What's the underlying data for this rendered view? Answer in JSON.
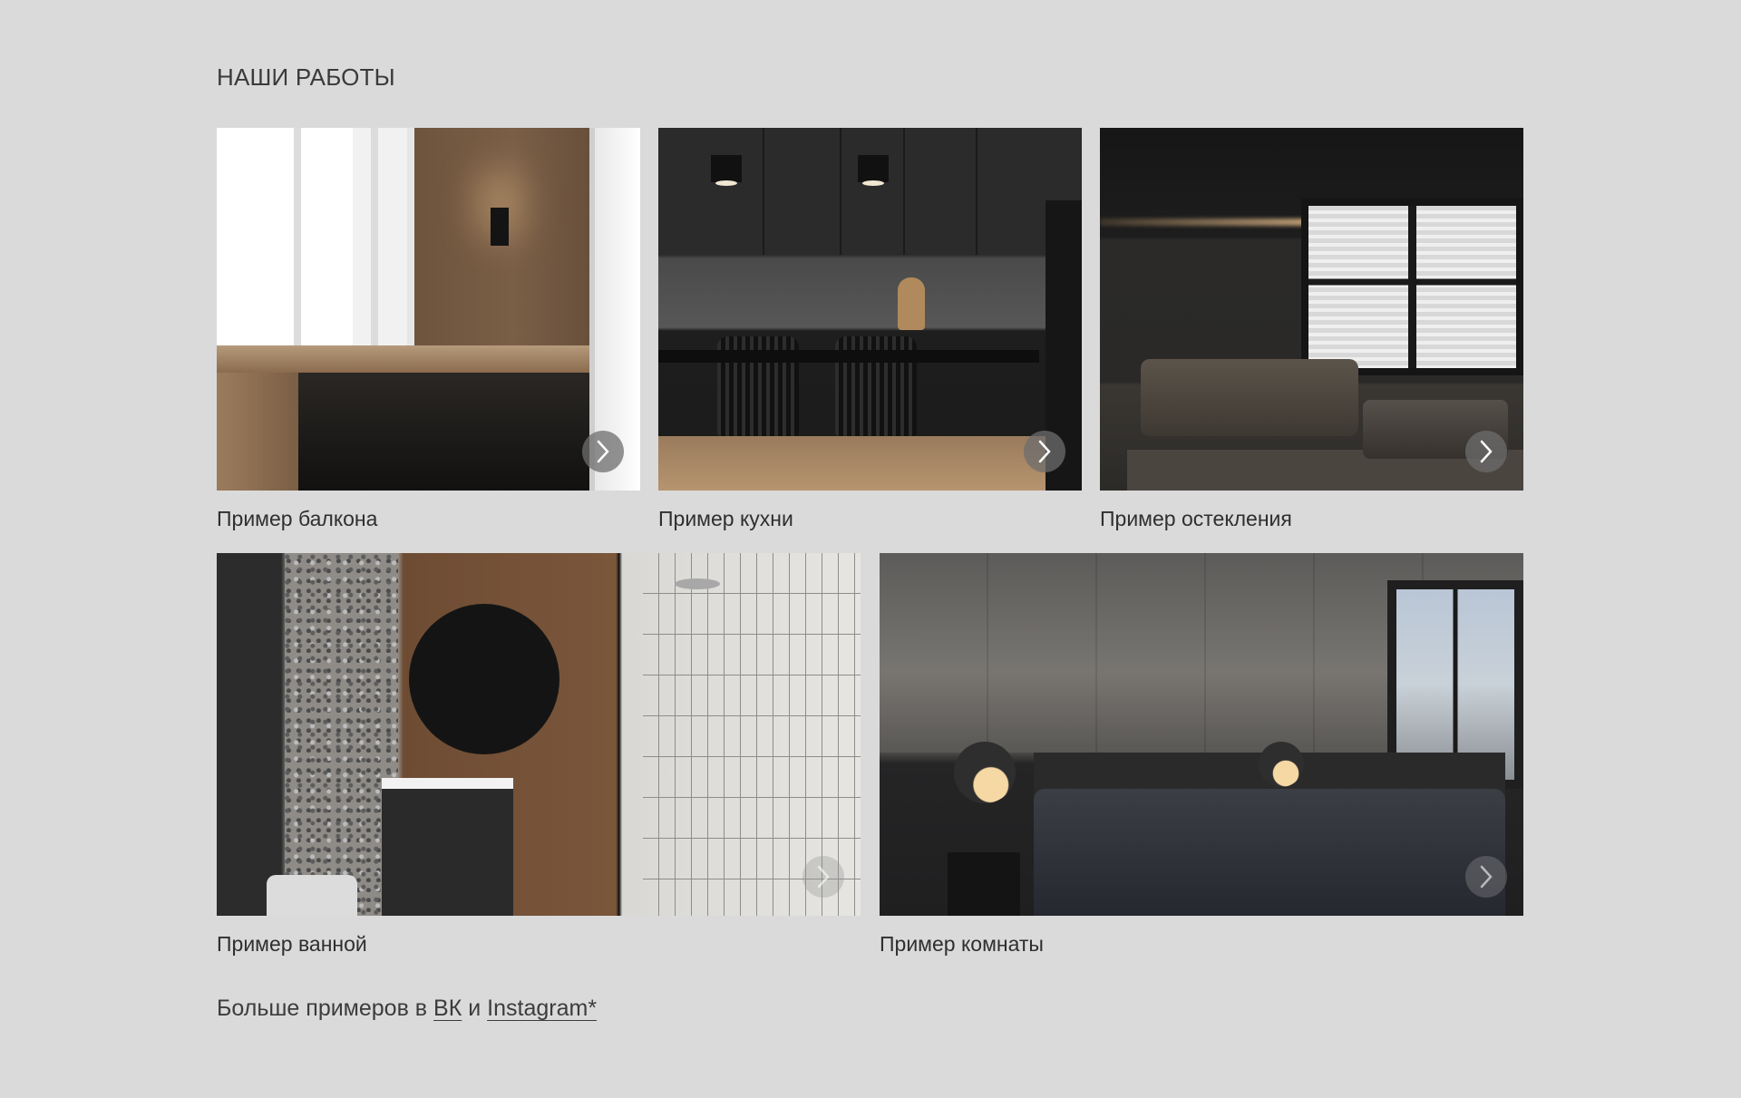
{
  "section": {
    "title": "НАШИ РАБОТЫ"
  },
  "cards": [
    {
      "caption": "Пример балкона",
      "image": "balcony-photo",
      "next_icon": "chevron-right-icon"
    },
    {
      "caption": "Пример кухни",
      "image": "kitchen-photo",
      "next_icon": "chevron-right-icon"
    },
    {
      "caption": "Пример остекления",
      "image": "glazing-photo",
      "next_icon": "chevron-right-icon"
    },
    {
      "caption": "Пример ванной",
      "image": "bathroom-photo",
      "next_icon": "chevron-right-icon"
    },
    {
      "caption": "Пример комнаты",
      "image": "bedroom-photo",
      "next_icon": "chevron-right-icon"
    }
  ],
  "more": {
    "prefix": "Больше примеров в ",
    "vk_label": "ВК",
    "conjunction": " и ",
    "instagram_label": "Instagram*"
  },
  "colors": {
    "background": "#dadada",
    "text": "#2f2f2f"
  }
}
